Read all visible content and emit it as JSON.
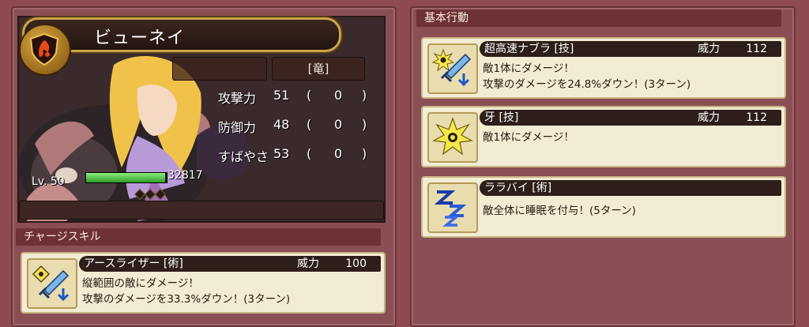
{
  "character": {
    "name": "ビューネイ",
    "type": "[竜]",
    "level": "Lv. 50",
    "hp": "32817",
    "hp_fraction": 0.98,
    "stats": [
      {
        "label": "攻撃力",
        "value": "51",
        "open": "(",
        "bonus": "0",
        "close": ")"
      },
      {
        "label": "防御力",
        "value": "48",
        "open": "(",
        "bonus": "0",
        "close": ")"
      },
      {
        "label": "すばやさ",
        "value": "53",
        "open": "(",
        "bonus": "0",
        "close": ")"
      }
    ]
  },
  "charge_section": {
    "title": "チャージスキル",
    "skill": {
      "name": "アースライザー [術]",
      "power_label": "威力",
      "power": "100",
      "desc1": "縦範囲の敵にダメージ！",
      "desc2": "攻撃のダメージを33.3%ダウン！(3ターン)",
      "icon": "sword-down-icon"
    }
  },
  "basic_section": {
    "title": "基本行動",
    "skills": [
      {
        "name": "超高速ナブラ [技]",
        "power_label": "威力",
        "power": "112",
        "desc1": "敵1体にダメージ！",
        "desc2": "攻撃のダメージを24.8%ダウン！(3ターン)",
        "icon": "burst-sword-icon"
      },
      {
        "name": "牙 [技]",
        "power_label": "威力",
        "power": "112",
        "desc1": "敵1体にダメージ！",
        "desc2": "",
        "icon": "burst-icon"
      },
      {
        "name": "ララバイ [術]",
        "power_label": "",
        "power": "",
        "desc1": "敵全体に睡眠を付与！(5ターン)",
        "desc2": "",
        "icon": "sleep-icon"
      }
    ]
  },
  "colors": {
    "accent_gold": "#c9a54a",
    "panel": "#8a4f54",
    "card": "#f2ecd4",
    "hp_green": "#2f9a2c"
  }
}
